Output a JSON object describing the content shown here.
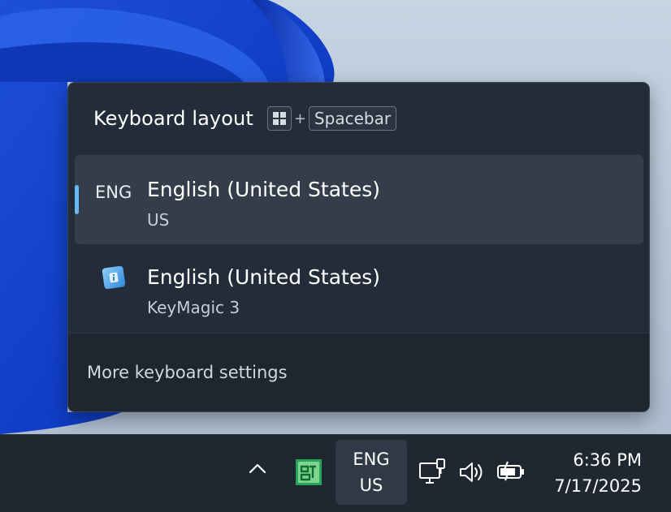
{
  "flyout": {
    "title": "Keyboard layout",
    "shortcut": {
      "icon": "windows-key-icon",
      "plus": "+",
      "key": "Spacebar"
    },
    "layouts": [
      {
        "code": "ENG",
        "name": "English (United States)",
        "variant": "US",
        "selected": true
      },
      {
        "icon": "keymagic-icon",
        "name": "English (United States)",
        "variant": "KeyMagic 3",
        "selected": false
      }
    ],
    "more_settings": "More keyboard settings"
  },
  "taskbar": {
    "language": {
      "line1": "ENG",
      "line2": "US"
    },
    "icons": [
      "chevron-up-icon",
      "keymagic-tray-icon",
      "network-icon",
      "volume-icon",
      "battery-charging-icon"
    ],
    "clock": {
      "time": "6:36 PM",
      "date": "7/17/2025"
    }
  },
  "colors": {
    "accent": "#67b9f2",
    "flyout_bg": "#232d39",
    "selected_row": "#343e4a",
    "taskbar_bg": "#1f2731"
  }
}
